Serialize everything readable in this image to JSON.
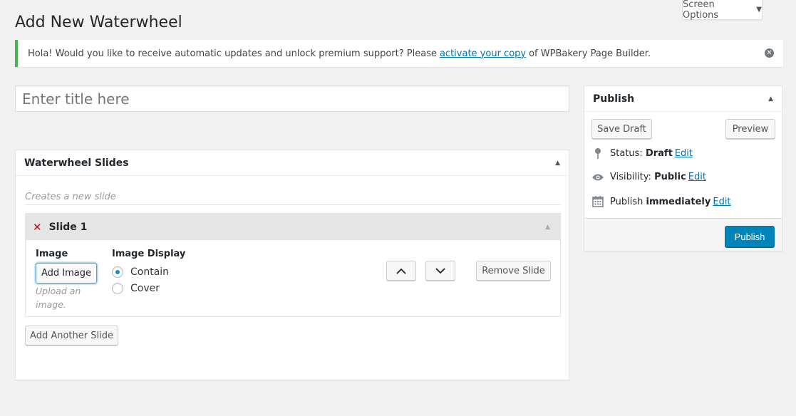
{
  "screen_options": {
    "label": "Screen Options"
  },
  "page": {
    "title": "Add New Waterwheel"
  },
  "notice": {
    "text_before": "Hola! Would you like to receive automatic updates and unlock premium support? Please",
    "link": "activate your copy",
    "text_after": "of WPBakery Page Builder."
  },
  "title_field": {
    "placeholder": "Enter title here",
    "value": ""
  },
  "slides_box": {
    "title": "Waterwheel Slides",
    "description": "Creates a new slide",
    "slides": [
      {
        "title": "Slide 1",
        "image_label": "Image",
        "add_image_label": "Add Image",
        "image_hint": "Upload an image.",
        "display_label": "Image Display",
        "display_options": [
          {
            "label": "Contain",
            "checked": true
          },
          {
            "label": "Cover",
            "checked": false
          }
        ],
        "remove_label": "Remove Slide"
      }
    ],
    "add_another_label": "Add Another Slide"
  },
  "publish_box": {
    "title": "Publish",
    "save_draft_label": "Save Draft",
    "preview_label": "Preview",
    "status_label": "Status:",
    "status_value": "Draft",
    "visibility_label": "Visibility:",
    "visibility_value": "Public",
    "publish_label": "Publish",
    "publish_value": "immediately",
    "edit_label": "Edit",
    "publish_button": "Publish"
  },
  "colors": {
    "accent": "#0085ba",
    "notice_border": "#46b450",
    "remove_x": "#dd0000"
  }
}
